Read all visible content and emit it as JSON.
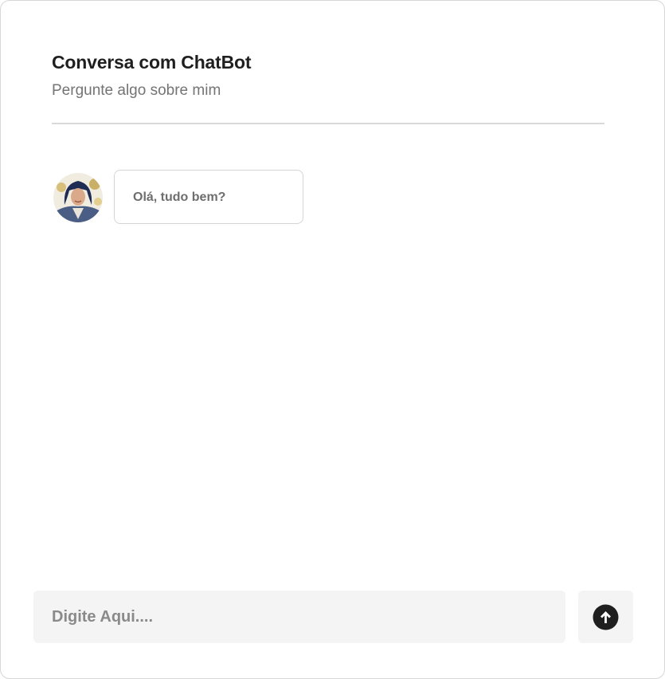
{
  "header": {
    "title": "Conversa com ChatBot",
    "subtitle": "Pergunte algo sobre mim"
  },
  "messages": [
    {
      "sender": "bot",
      "avatar_icon": "user-avatar",
      "text": "Olá, tudo bem?"
    }
  ],
  "composer": {
    "placeholder": "Digite Aqui....",
    "value": "",
    "send_icon": "arrow-up-circle-icon"
  },
  "colors": {
    "title": "#1f1f1f",
    "subtitle": "#747474",
    "input_bg": "#f4f4f4",
    "send_icon": "#1f1f1f"
  }
}
